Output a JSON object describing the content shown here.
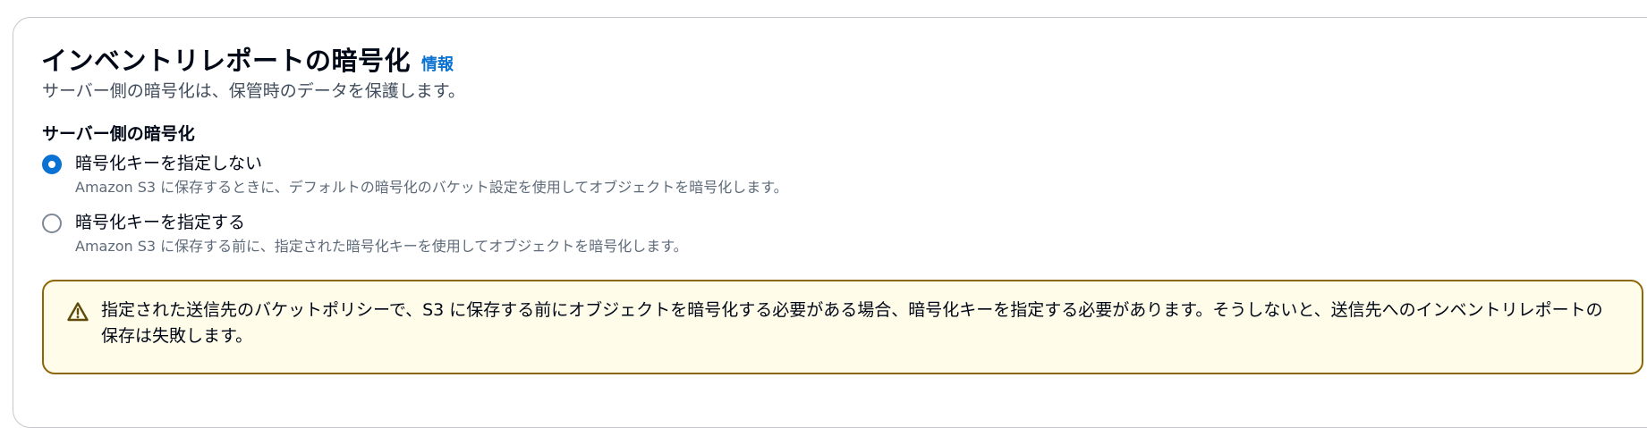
{
  "section": {
    "title": "インベントリレポートの暗号化",
    "info_link": "情報",
    "description": "サーバー側の暗号化は、保管時のデータを保護します。"
  },
  "encryption": {
    "label": "サーバー側の暗号化",
    "options": [
      {
        "label": "暗号化キーを指定しない",
        "description": "Amazon S3 に保存するときに、デフォルトの暗号化のバケット設定を使用してオブジェクトを暗号化します。",
        "selected": true
      },
      {
        "label": "暗号化キーを指定する",
        "description": "Amazon S3 に保存する前に、指定された暗号化キーを使用してオブジェクトを暗号化します。",
        "selected": false
      }
    ]
  },
  "warning": {
    "text": "指定された送信先のバケットポリシーで、S3 に保存する前にオブジェクトを暗号化する必要がある場合、暗号化キーを指定する必要があります。そうしないと、送信先へのインベントリレポートの保存は失敗します。",
    "icon": "warning-triangle-icon"
  },
  "colors": {
    "accent": "#0972d3",
    "warning_border": "#8d6605",
    "warning_background": "#fffce9"
  }
}
